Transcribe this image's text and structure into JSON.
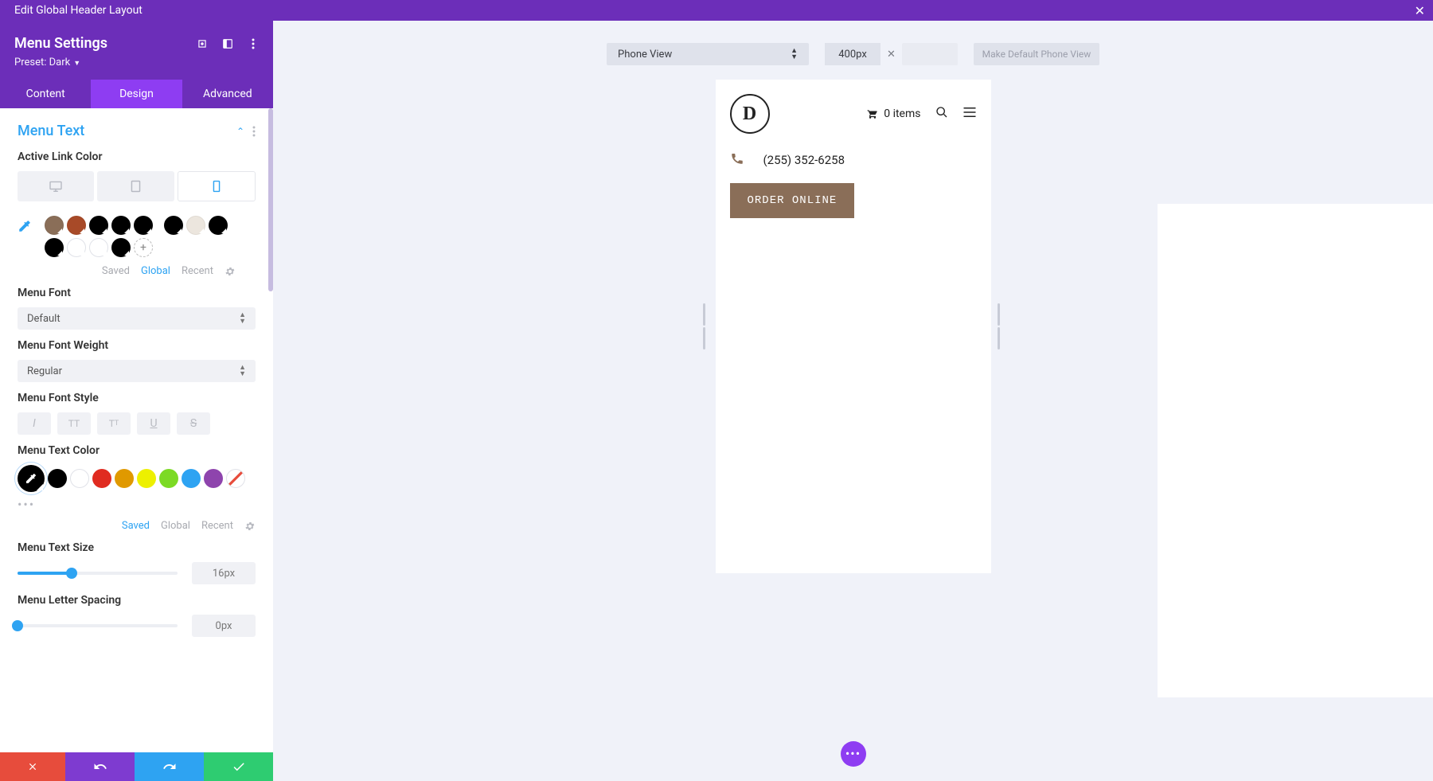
{
  "topbar": {
    "title": "Edit Global Header Layout"
  },
  "sidebar": {
    "title": "Menu Settings",
    "preset_label": "Preset: ",
    "preset_value": "Dark",
    "tabs": {
      "content": "Content",
      "design": "Design",
      "advanced": "Advanced",
      "active": "design"
    },
    "section_title": "Menu Text",
    "labels": {
      "active_link_color": "Active Link Color",
      "menu_font": "Menu Font",
      "menu_font_weight": "Menu Font Weight",
      "menu_font_style": "Menu Font Style",
      "menu_text_color": "Menu Text Color",
      "menu_text_size": "Menu Text Size",
      "menu_letter_spacing": "Menu Letter Spacing"
    },
    "palette_tabs": {
      "saved": "Saved",
      "global": "Global",
      "recent": "Recent"
    },
    "active_link_palette": {
      "active_tab": "global",
      "colors_row1": [
        "#8a6e58",
        "#a84a28",
        "#000000",
        "#000000",
        "#000000",
        "#000000",
        "#ece6de",
        "#000000",
        "#000000"
      ],
      "colors_row2": [
        "#ffffff",
        "#ffffff",
        "#000000"
      ]
    },
    "menu_font_value": "Default",
    "menu_font_weight_value": "Regular",
    "text_color_palette": {
      "active_tab": "saved",
      "colors": [
        "#000000",
        "#ffffff",
        "#e02b20",
        "#e09900",
        "#edf000",
        "#7cda24",
        "#2ea3f2",
        "#8e44ad"
      ]
    },
    "text_size": {
      "value": "16px",
      "percent": 34
    },
    "letter_spacing": {
      "value": "0px",
      "percent": 0
    }
  },
  "canvas": {
    "view_label": "Phone View",
    "width_value": "400px",
    "make_default": "Make Default Phone View"
  },
  "preview": {
    "cart_text": "0 items",
    "phone_number": "(255) 352-6258",
    "order_button": "ORDER ONLINE"
  }
}
